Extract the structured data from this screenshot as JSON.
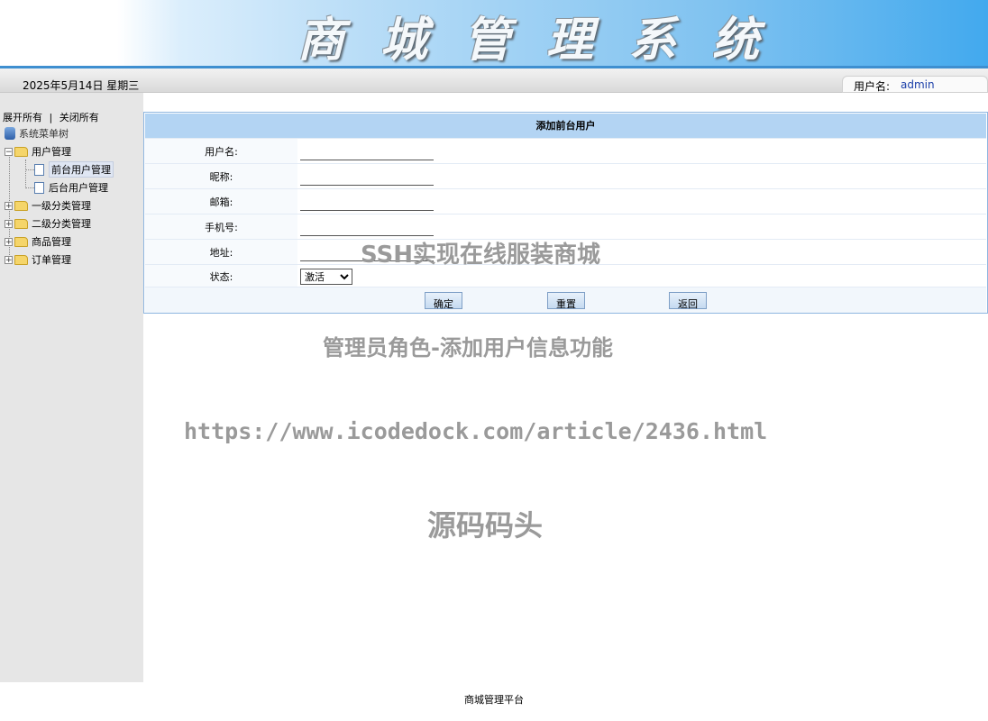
{
  "header": {
    "title": "商城管理系统",
    "date": "2025年5月14日 星期三",
    "user_label": "用户名:",
    "username": "admin"
  },
  "sidebar": {
    "expand_all": "展开所有",
    "separator": "|",
    "collapse_all": "关闭所有",
    "root": "系统菜单树",
    "nodes": [
      {
        "label": "用户管理",
        "expanded": true,
        "children": [
          {
            "label": "前台用户管理",
            "selected": true
          },
          {
            "label": "后台用户管理",
            "selected": false
          }
        ]
      },
      {
        "label": "一级分类管理",
        "expanded": false
      },
      {
        "label": "二级分类管理",
        "expanded": false
      },
      {
        "label": "商品管理",
        "expanded": false
      },
      {
        "label": "订单管理",
        "expanded": false
      }
    ]
  },
  "form": {
    "title": "添加前台用户",
    "fields": [
      {
        "label": "用户名:",
        "value": ""
      },
      {
        "label": "昵称:",
        "value": ""
      },
      {
        "label": "邮箱:",
        "value": ""
      },
      {
        "label": "手机号:",
        "value": ""
      },
      {
        "label": "地址:",
        "value": ""
      }
    ],
    "status": {
      "label": "状态:",
      "selected": "激活"
    },
    "buttons": {
      "confirm": "确定",
      "reset": "重置",
      "back": "返回"
    }
  },
  "watermarks": {
    "line1": "SSH实现在线服装商城",
    "line2": "管理员角色-添加用户信息功能",
    "line3": "https://www.icodedock.com/article/2436.html",
    "line4": "源码码头"
  },
  "footer": "商城管理平台",
  "colors": {
    "banner_accent": "#42a9ee",
    "panel_header": "#b3d4f3",
    "sidebar_bg": "#e6e6e6"
  }
}
